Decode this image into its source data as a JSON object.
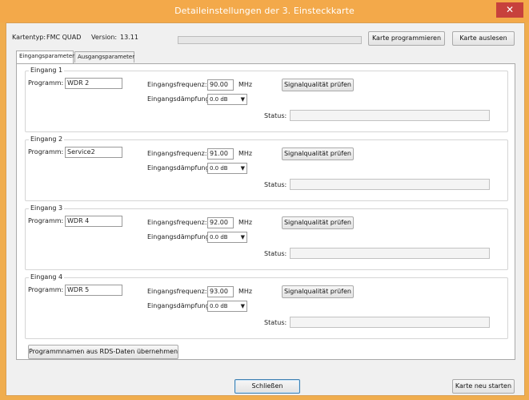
{
  "window": {
    "title": "Detaileinstellungen der 3. Einsteckkarte",
    "close_glyph": "✕"
  },
  "header": {
    "card_type_label": "Kartentyp:",
    "card_type_value": "FMC QUAD",
    "version_label": "Version:",
    "version_value": "13.11",
    "program_button": "Karte programmieren",
    "read_button": "Karte auslesen"
  },
  "tabs": [
    {
      "label": "Eingangsparameter",
      "active": true
    },
    {
      "label": "Ausgangsparameter",
      "active": false
    }
  ],
  "inputs": [
    {
      "title": "Eingang 1",
      "program_label": "Programm:",
      "program_value": "WDR 2",
      "freq_label": "Eingangsfrequenz:",
      "freq_value": "90.00",
      "freq_unit": "MHz",
      "atten_label": "Eingangsdämpfung:",
      "atten_value": "0.0 dB",
      "check_button": "Signalqualität prüfen",
      "status_label": "Status:",
      "status_value": ""
    },
    {
      "title": "Eingang 2",
      "program_label": "Programm:",
      "program_value": "Service2",
      "freq_label": "Eingangsfrequenz:",
      "freq_value": "91.00",
      "freq_unit": "MHz",
      "atten_label": "Eingangsdämpfung:",
      "atten_value": "0.0 dB",
      "check_button": "Signalqualität prüfen",
      "status_label": "Status:",
      "status_value": ""
    },
    {
      "title": "Eingang 3",
      "program_label": "Programm:",
      "program_value": "WDR 4",
      "freq_label": "Eingangsfrequenz:",
      "freq_value": "92.00",
      "freq_unit": "MHz",
      "atten_label": "Eingangsdämpfung:",
      "atten_value": "0.0 dB",
      "check_button": "Signalqualität prüfen",
      "status_label": "Status:",
      "status_value": ""
    },
    {
      "title": "Eingang 4",
      "program_label": "Programm:",
      "program_value": "WDR 5",
      "freq_label": "Eingangsfrequenz:",
      "freq_value": "93.00",
      "freq_unit": "MHz",
      "atten_label": "Eingangsdämpfung:",
      "atten_value": "0.0 dB",
      "check_button": "Signalqualität prüfen",
      "status_label": "Status:",
      "status_value": ""
    }
  ],
  "rds_button": "Programmnamen aus RDS-Daten übernehmen",
  "footer": {
    "close_button": "Schließen",
    "restart_button": "Karte neu starten"
  },
  "colors": {
    "title_bar": "#f3a94a",
    "close_button": "#c7413c",
    "client_bg": "#f0f0f0"
  }
}
